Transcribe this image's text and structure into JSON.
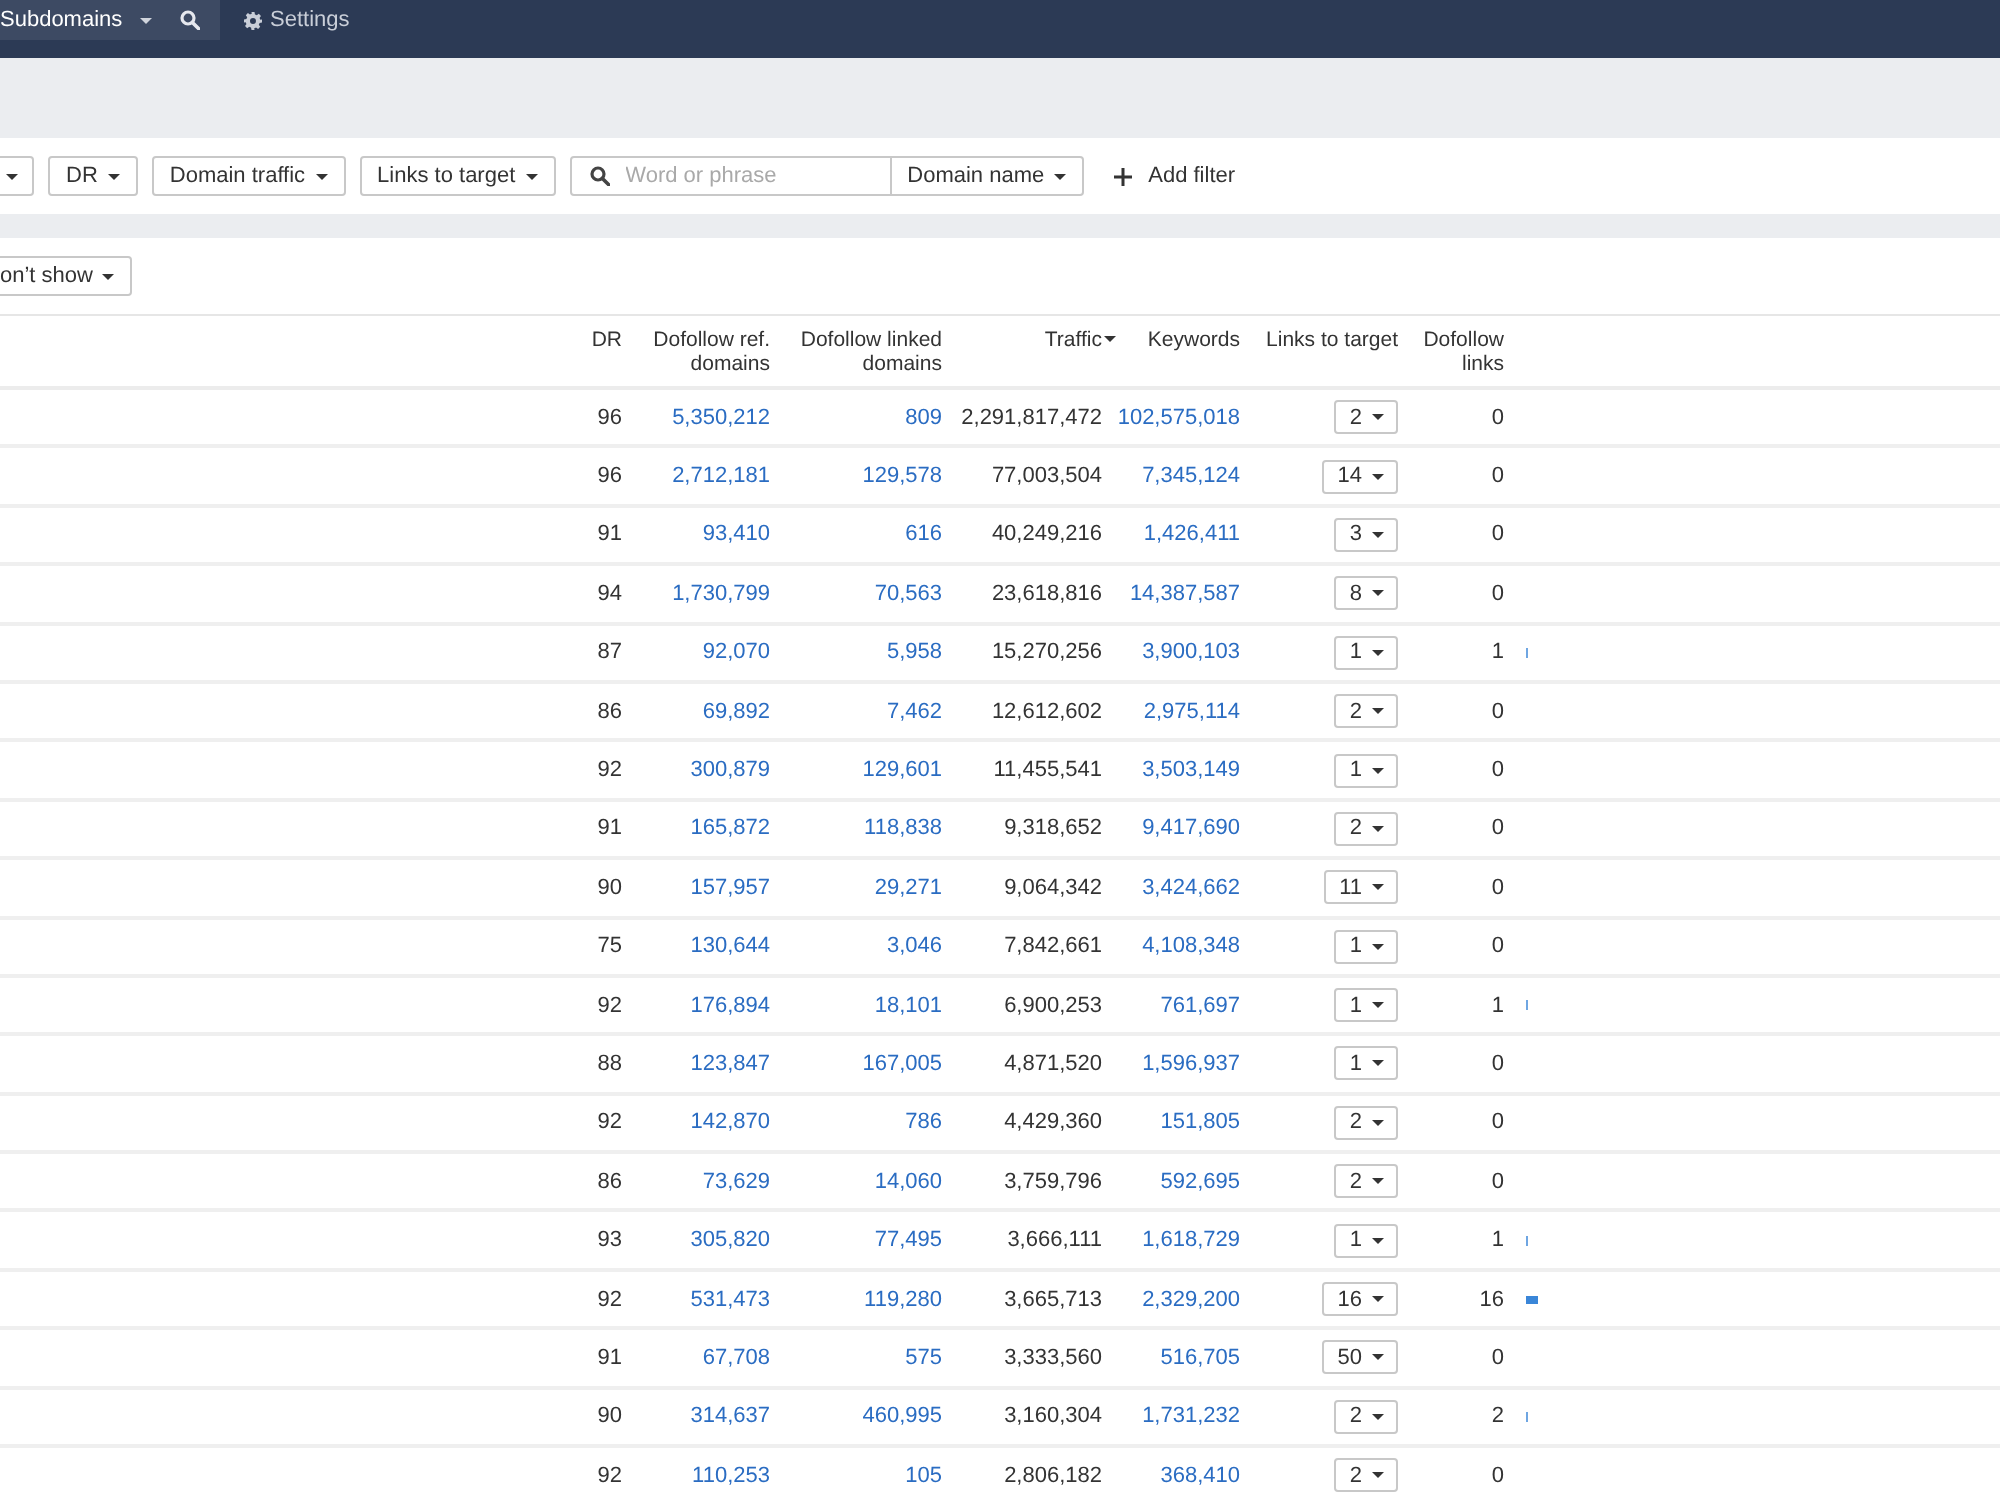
{
  "top_bar": {
    "mode_dropdown": {
      "label": "Subdomains"
    },
    "settings": {
      "label": "Settings"
    }
  },
  "filters": [
    {
      "kind": "clipped"
    },
    {
      "kind": "dropdown",
      "label": "DR"
    },
    {
      "kind": "dropdown",
      "label": "Domain traffic"
    },
    {
      "kind": "dropdown",
      "label": "Links to target"
    },
    {
      "kind": "search",
      "placeholder": "Word or phrase"
    },
    {
      "kind": "scope",
      "label": "Domain name"
    },
    {
      "kind": "add",
      "label": "Add filter"
    }
  ],
  "display_dropdown": {
    "label": "on’t show"
  },
  "table": {
    "columns": [
      {
        "label": "DR",
        "kind": "number",
        "sorted": false
      },
      {
        "label": "Dofollow ref. domains",
        "kind": "link",
        "sorted": false
      },
      {
        "label": "Dofollow linked domains",
        "kind": "link",
        "sorted": false
      },
      {
        "label": "Traffic",
        "kind": "number",
        "sorted": true
      },
      {
        "label": "Keywords",
        "kind": "link",
        "sorted": false
      },
      {
        "label": "Links to target",
        "kind": "dropdown",
        "sorted": false
      },
      {
        "label": "Dofollow links",
        "kind": "number",
        "sorted": false
      }
    ],
    "rows": [
      {
        "kind": "plain",
        "cells": [
          "96",
          "5,350,212",
          "809",
          "2,291,817,472",
          "102,575,018",
          "2",
          "0"
        ]
      },
      {
        "kind": "plain",
        "cells": [
          "96",
          "2,712,181",
          "129,578",
          "77,003,504",
          "7,345,124",
          "14",
          "0"
        ]
      },
      {
        "kind": "plain",
        "cells": [
          "91",
          "93,410",
          "616",
          "40,249,216",
          "1,426,411",
          "3",
          "0"
        ]
      },
      {
        "kind": "plain",
        "cells": [
          "94",
          "1,730,799",
          "70,563",
          "23,618,816",
          "14,387,587",
          "8",
          "0"
        ]
      },
      {
        "kind": "tick",
        "cells": [
          "87",
          "92,070",
          "5,958",
          "15,270,256",
          "3,900,103",
          "1",
          "1"
        ]
      },
      {
        "kind": "plain",
        "cells": [
          "86",
          "69,892",
          "7,462",
          "12,612,602",
          "2,975,114",
          "2",
          "0"
        ]
      },
      {
        "kind": "plain",
        "cells": [
          "92",
          "300,879",
          "129,601",
          "11,455,541",
          "3,503,149",
          "1",
          "0"
        ]
      },
      {
        "kind": "plain",
        "cells": [
          "91",
          "165,872",
          "118,838",
          "9,318,652",
          "9,417,690",
          "2",
          "0"
        ]
      },
      {
        "kind": "plain",
        "cells": [
          "90",
          "157,957",
          "29,271",
          "9,064,342",
          "3,424,662",
          "11",
          "0"
        ]
      },
      {
        "kind": "plain",
        "cells": [
          "75",
          "130,644",
          "3,046",
          "7,842,661",
          "4,108,348",
          "1",
          "0"
        ]
      },
      {
        "kind": "tick",
        "cells": [
          "92",
          "176,894",
          "18,101",
          "6,900,253",
          "761,697",
          "1",
          "1"
        ]
      },
      {
        "kind": "plain",
        "cells": [
          "88",
          "123,847",
          "167,005",
          "4,871,520",
          "1,596,937",
          "1",
          "0"
        ]
      },
      {
        "kind": "plain",
        "cells": [
          "92",
          "142,870",
          "786",
          "4,429,360",
          "151,805",
          "2",
          "0"
        ]
      },
      {
        "kind": "plain",
        "cells": [
          "86",
          "73,629",
          "14,060",
          "3,759,796",
          "592,695",
          "2",
          "0"
        ]
      },
      {
        "kind": "tick",
        "cells": [
          "93",
          "305,820",
          "77,495",
          "3,666,111",
          "1,618,729",
          "1",
          "1"
        ]
      },
      {
        "kind": "bar",
        "cells": [
          "92",
          "531,473",
          "119,280",
          "3,665,713",
          "2,329,200",
          "16",
          "16"
        ]
      },
      {
        "kind": "plain",
        "cells": [
          "91",
          "67,708",
          "575",
          "3,333,560",
          "516,705",
          "50",
          "0"
        ]
      },
      {
        "kind": "tick",
        "cells": [
          "90",
          "314,637",
          "460,995",
          "3,160,304",
          "1,731,232",
          "2",
          "2"
        ]
      },
      {
        "kind": "plain",
        "cells": [
          "92",
          "110,253",
          "105",
          "2,806,182",
          "368,410",
          "2",
          "0"
        ]
      }
    ]
  }
}
